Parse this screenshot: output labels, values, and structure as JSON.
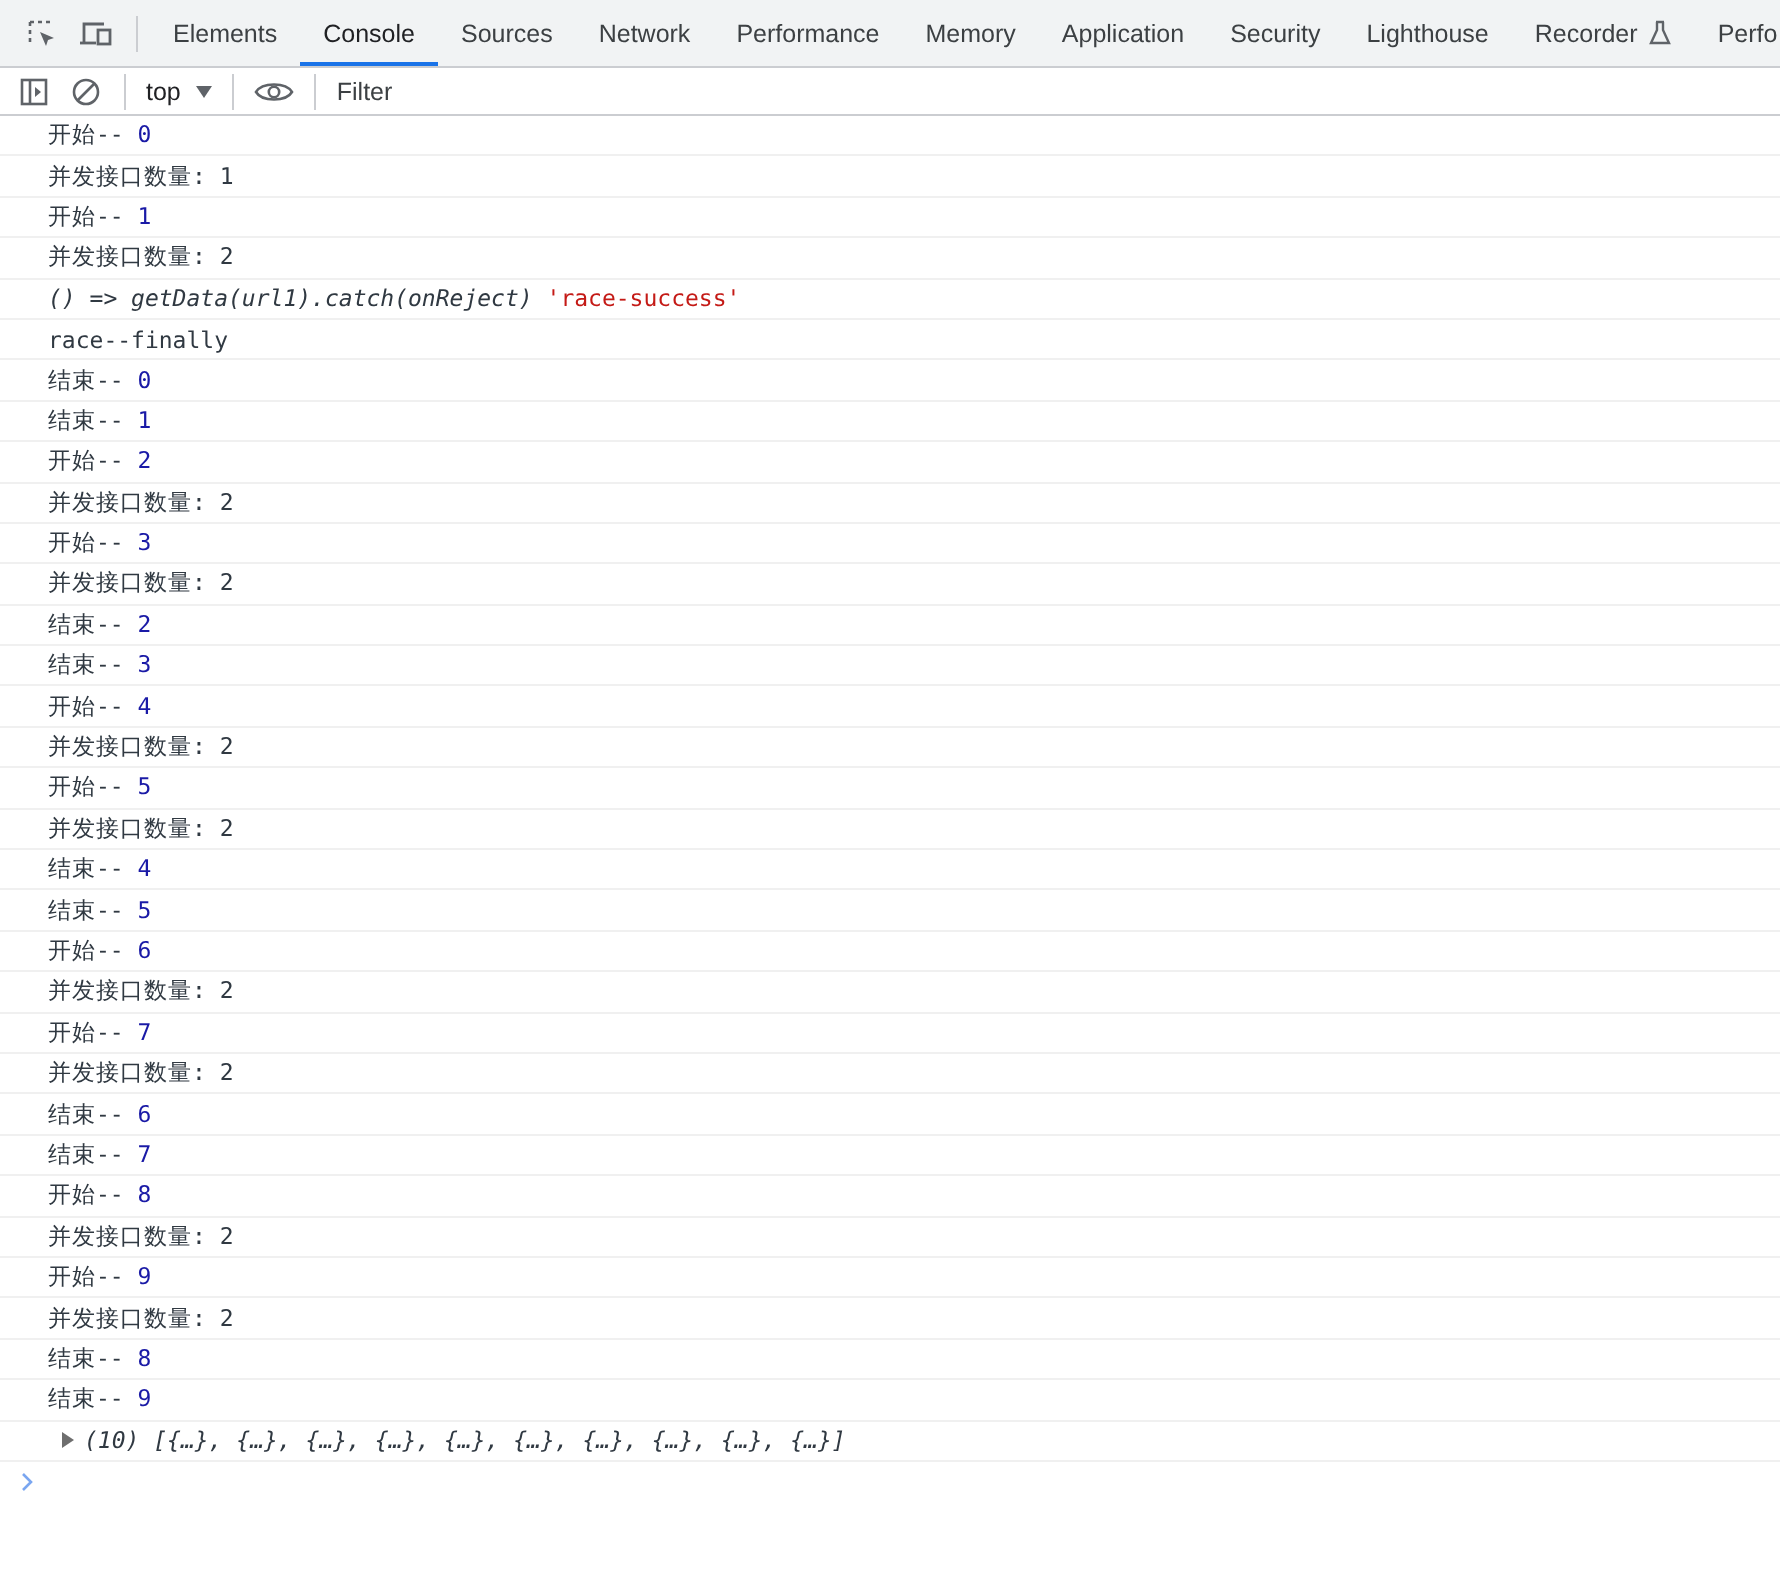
{
  "tabs": [
    {
      "label": "Elements",
      "selected": false
    },
    {
      "label": "Console",
      "selected": true
    },
    {
      "label": "Sources",
      "selected": false
    },
    {
      "label": "Network",
      "selected": false
    },
    {
      "label": "Performance",
      "selected": false
    },
    {
      "label": "Memory",
      "selected": false
    },
    {
      "label": "Application",
      "selected": false
    },
    {
      "label": "Security",
      "selected": false
    },
    {
      "label": "Lighthouse",
      "selected": false
    },
    {
      "label": "Recorder",
      "selected": false,
      "experimental": true
    },
    {
      "label": "Perfo",
      "selected": false
    }
  ],
  "toolbar": {
    "context": "top",
    "filter": {
      "placeholder": "Filter"
    }
  },
  "messages": [
    {
      "kind": "pair",
      "label": "开始--",
      "value": "0"
    },
    {
      "kind": "text",
      "text": "并发接口数量: 1"
    },
    {
      "kind": "pair",
      "label": "开始--",
      "value": "1"
    },
    {
      "kind": "text",
      "text": "并发接口数量: 2"
    },
    {
      "kind": "fn",
      "text": "() => getData(url1).catch(onReject)",
      "value": "'race-success'"
    },
    {
      "kind": "text",
      "text": "race--finally"
    },
    {
      "kind": "pair",
      "label": "结束--",
      "value": "0"
    },
    {
      "kind": "pair",
      "label": "结束--",
      "value": "1"
    },
    {
      "kind": "pair",
      "label": "开始--",
      "value": "2"
    },
    {
      "kind": "text",
      "text": "并发接口数量: 2"
    },
    {
      "kind": "pair",
      "label": "开始--",
      "value": "3"
    },
    {
      "kind": "text",
      "text": "并发接口数量: 2"
    },
    {
      "kind": "pair",
      "label": "结束--",
      "value": "2"
    },
    {
      "kind": "pair",
      "label": "结束--",
      "value": "3"
    },
    {
      "kind": "pair",
      "label": "开始--",
      "value": "4"
    },
    {
      "kind": "text",
      "text": "并发接口数量: 2"
    },
    {
      "kind": "pair",
      "label": "开始--",
      "value": "5"
    },
    {
      "kind": "text",
      "text": "并发接口数量: 2"
    },
    {
      "kind": "pair",
      "label": "结束--",
      "value": "4"
    },
    {
      "kind": "pair",
      "label": "结束--",
      "value": "5"
    },
    {
      "kind": "pair",
      "label": "开始--",
      "value": "6"
    },
    {
      "kind": "text",
      "text": "并发接口数量: 2"
    },
    {
      "kind": "pair",
      "label": "开始--",
      "value": "7"
    },
    {
      "kind": "text",
      "text": "并发接口数量: 2"
    },
    {
      "kind": "pair",
      "label": "结束--",
      "value": "6"
    },
    {
      "kind": "pair",
      "label": "结束--",
      "value": "7"
    },
    {
      "kind": "pair",
      "label": "开始--",
      "value": "8"
    },
    {
      "kind": "text",
      "text": "并发接口数量: 2"
    },
    {
      "kind": "pair",
      "label": "开始--",
      "value": "9"
    },
    {
      "kind": "text",
      "text": "并发接口数量: 2"
    },
    {
      "kind": "pair",
      "label": "结束--",
      "value": "8"
    },
    {
      "kind": "pair",
      "label": "结束--",
      "value": "9"
    },
    {
      "kind": "array",
      "text": "(10) [{…}, {…}, {…}, {…}, {…}, {…}, {…}, {…}, {…}, {…}]",
      "expanded": false
    }
  ]
}
